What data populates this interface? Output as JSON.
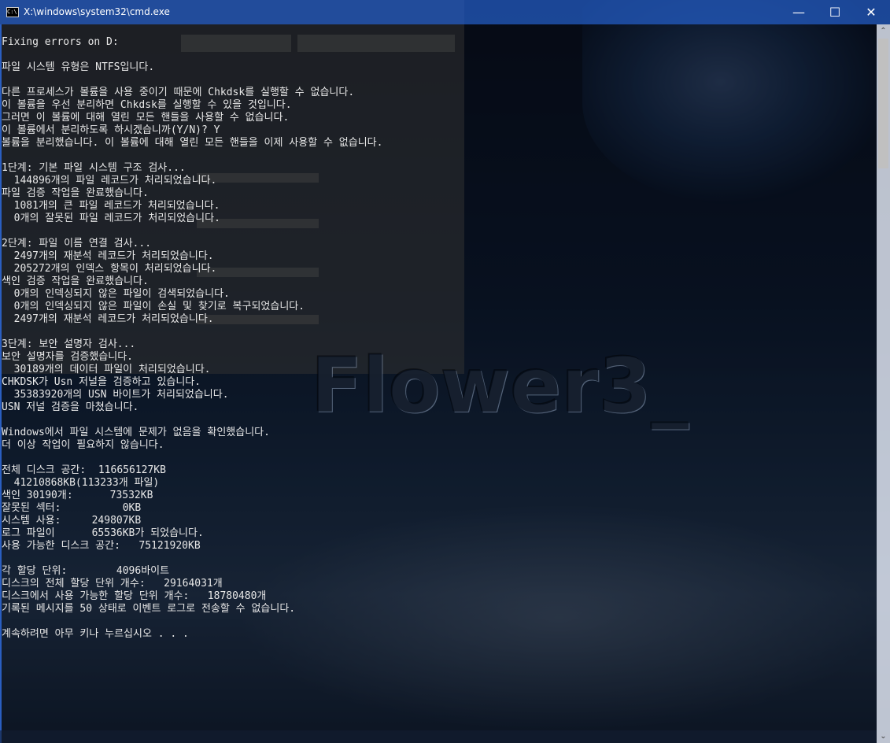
{
  "window": {
    "title": "X:\\windows\\system32\\cmd.exe",
    "icon": "cmd-icon",
    "icon_text": "C:\\.",
    "controls": {
      "minimize": "—",
      "maximize": "☐",
      "close": "✕"
    }
  },
  "background": {
    "watermark": "Flower3_",
    "accent": "#1f50aa"
  },
  "console": {
    "lines": [
      "Fixing errors on D:",
      "",
      "파일 시스템 유형은 NTFS입니다.",
      "",
      "다른 프로세스가 볼륨을 사용 중이기 때문에 Chkdsk를 실행할 수 없습니다.",
      "이 볼륨을 우선 분리하면 Chkdsk를 실행할 수 있을 것입니다.",
      "그러면 이 볼륨에 대해 열린 모든 핸들을 사용할 수 없습니다.",
      "이 볼륨에서 분리하도록 하시겠습니까(Y/N)? Y",
      "볼륨을 분리했습니다. 이 볼륨에 대해 열린 모든 핸들을 이제 사용할 수 없습니다.",
      "",
      "1단계: 기본 파일 시스템 구조 검사...",
      "  144896개의 파일 레코드가 처리되었습니다.",
      "파일 검증 작업을 완료했습니다.",
      "  1081개의 큰 파일 레코드가 처리되었습니다.",
      "  0개의 잘못된 파일 레코드가 처리되었습니다.",
      "",
      "2단계: 파일 이름 연결 검사...",
      "  2497개의 재분석 레코드가 처리되었습니다.",
      "  205272개의 인덱스 항목이 처리되었습니다.",
      "색인 검증 작업을 완료했습니다.",
      "  0개의 인덱싱되지 않은 파일이 검색되었습니다.",
      "  0개의 인덱싱되지 않은 파일이 손실 및 찾기로 복구되었습니다.",
      "  2497개의 재분석 레코드가 처리되었습니다.",
      "",
      "3단계: 보안 설명자 검사...",
      "보안 설명자를 검증했습니다.",
      "  30189개의 데이터 파일이 처리되었습니다.",
      "CHKDSK가 Usn 저널을 검증하고 있습니다.",
      "  35383920개의 USN 바이트가 처리되었습니다.",
      "USN 저널 검증을 마쳤습니다.",
      "",
      "Windows에서 파일 시스템에 문제가 없음을 확인했습니다.",
      "더 이상 작업이 필요하지 않습니다.",
      "",
      "전체 디스크 공간:  116656127KB",
      "  41210868KB(113233개 파일)",
      "색인 30190개:      73532KB",
      "잘못된 섹터:          0KB",
      "시스템 사용:     249807KB",
      "로그 파일이      65536KB가 되었습니다.",
      "사용 가능한 디스크 공간:   75121920KB",
      "",
      "각 할당 단위:        4096바이트",
      "디스크의 전체 할당 단위 개수:   29164031개",
      "디스크에서 사용 가능한 할당 단위 개수:   18780480개",
      "기록된 메시지를 50 상태로 이벤트 로그로 전송할 수 없습니다.",
      "",
      "계속하려면 아무 키나 누르십시오 . . ."
    ]
  },
  "scrollbar": {
    "up": "⌃",
    "down": "⌄"
  }
}
